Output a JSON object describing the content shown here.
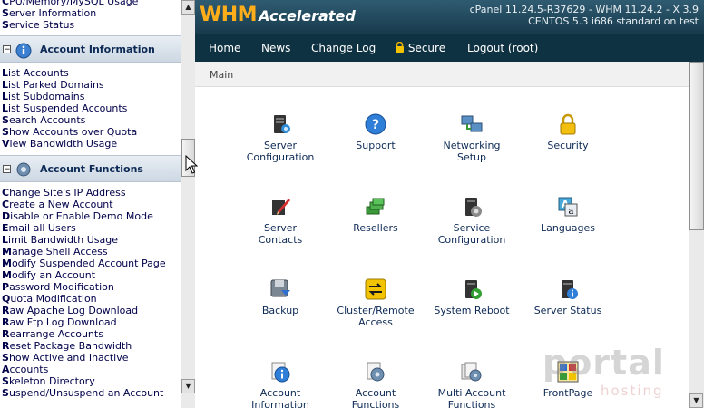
{
  "left_panel": {
    "top_links": [
      "CPU/Memory/MySQL Usage",
      "Server Information",
      "Service Status"
    ],
    "account_information": {
      "title": "Account Information",
      "items": [
        "List Accounts",
        "List Parked Domains",
        "List Subdomains",
        "List Suspended Accounts",
        "Search Accounts",
        "Show Accounts over Quota",
        "View Bandwidth Usage"
      ]
    },
    "account_functions": {
      "title": "Account Functions",
      "items": [
        "Change Site's IP Address",
        "Create a New Account",
        "Disable or Enable Demo Mode",
        "Email all Users",
        "Limit Bandwidth Usage",
        "Manage Shell Access",
        "Modify Suspended Account Page",
        "Modify an Account",
        "Password Modification",
        "Quota Modification",
        "Raw Apache Log Download",
        "Raw Ftp Log Download",
        "Rearrange Accounts",
        "Reset Package Bandwidth",
        "Show Active and Inactive",
        "Accounts",
        "Skeleton Directory",
        "Suspend/Unsuspend an Account"
      ]
    }
  },
  "header": {
    "logo_whm": "WHM",
    "logo_accelerated": "Accelerated",
    "version_line1": "cPanel 11.24.5-R37629 - WHM 11.24.2 - X 3.9",
    "version_line2": "CENTOS 5.3 i686 standard on test"
  },
  "nav": {
    "home": "Home",
    "news": "News",
    "change_log": "Change Log",
    "secure": "Secure",
    "logout": "Logout (root)"
  },
  "breadcrumb": "Main",
  "tiles": [
    {
      "label": "Server\nConfiguration",
      "icon": "server-config-icon"
    },
    {
      "label": "Support",
      "icon": "support-icon"
    },
    {
      "label": "Networking\nSetup",
      "icon": "networking-icon"
    },
    {
      "label": "Security",
      "icon": "security-lock-icon"
    },
    {
      "label": "Server\nContacts",
      "icon": "server-contacts-icon"
    },
    {
      "label": "Resellers",
      "icon": "resellers-icon"
    },
    {
      "label": "Service\nConfiguration",
      "icon": "service-config-icon"
    },
    {
      "label": "Languages",
      "icon": "languages-icon"
    },
    {
      "label": "Backup",
      "icon": "backup-icon"
    },
    {
      "label": "Cluster/Remote\nAccess",
      "icon": "cluster-remote-icon"
    },
    {
      "label": "System Reboot",
      "icon": "system-reboot-icon"
    },
    {
      "label": "Server Status",
      "icon": "server-status-icon"
    },
    {
      "label": "Account\nInformation",
      "icon": "account-information-icon"
    },
    {
      "label": "Account\nFunctions",
      "icon": "account-functions-icon"
    },
    {
      "label": "Multi Account\nFunctions",
      "icon": "multi-account-icon"
    },
    {
      "label": "FrontPage",
      "icon": "frontpage-icon"
    }
  ],
  "watermark": {
    "big": "portal",
    "small": "hosting"
  }
}
